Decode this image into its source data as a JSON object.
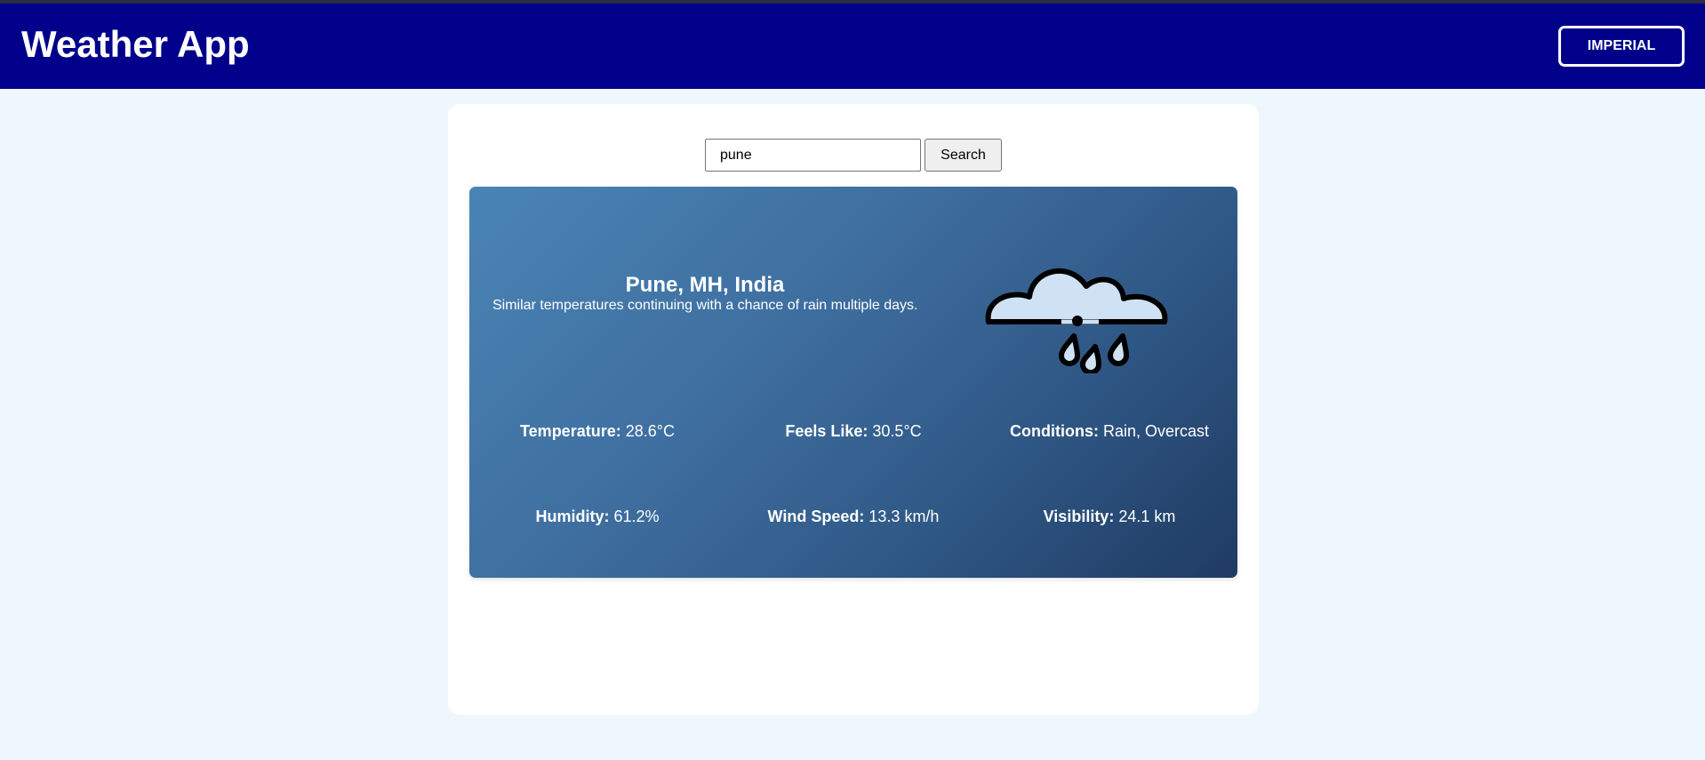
{
  "header": {
    "title": "Weather App",
    "units_toggle_label": "IMPERIAL"
  },
  "search": {
    "value": "pune",
    "button_label": "Search"
  },
  "weather": {
    "location": "Pune, MH, India",
    "forecast": "Similar temperatures continuing with a chance of rain multiple days.",
    "icon": "rain-cloud-icon",
    "stats": [
      {
        "label": "Temperature:",
        "value": "28.6°C"
      },
      {
        "label": "Feels Like:",
        "value": "30.5°C"
      },
      {
        "label": "Conditions:",
        "value": "Rain, Overcast"
      },
      {
        "label": "Humidity:",
        "value": "61.2%"
      },
      {
        "label": "Wind Speed:",
        "value": "13.3 km/h"
      },
      {
        "label": "Visibility:",
        "value": "24.1 km"
      }
    ]
  },
  "colors": {
    "header_bg": "#00008b",
    "page_bg": "#eff7fe",
    "card_gradient_start": "#4a84b6",
    "card_gradient_end": "#1f3b62",
    "cloud_fill": "#cfe2f3"
  }
}
